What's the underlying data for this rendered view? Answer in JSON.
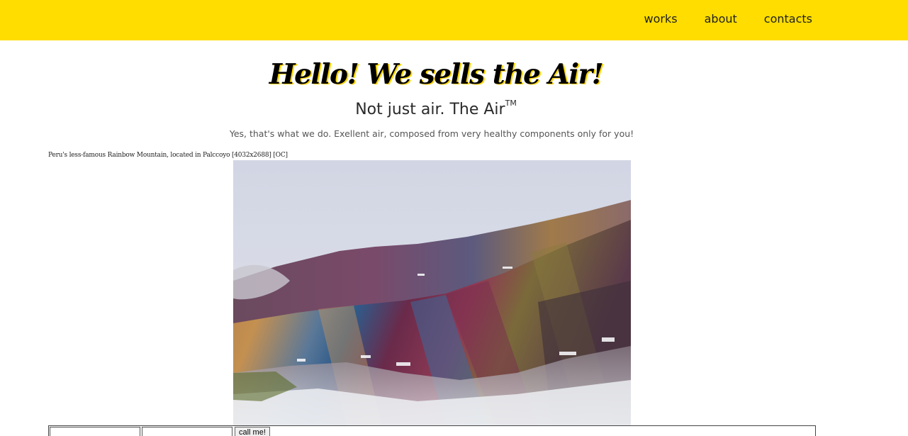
{
  "nav": {
    "items": [
      {
        "label": "works"
      },
      {
        "label": "about"
      },
      {
        "label": "contacts"
      }
    ]
  },
  "hero": {
    "headline": "Hello! We sells the Air!",
    "subheadline": "Not just air. The Air",
    "trademark": "TM",
    "tagline": "Yes, that's what we do. Exellent air, composed from very healthy components only for you!"
  },
  "image": {
    "caption": "Peru's less-famous Rainbow Mountain, located in Palccoyo [4032x2688] [OC]",
    "subject": "rainbow-mountain-photo"
  },
  "form": {
    "field1_value": "",
    "field2_value": "",
    "submit_label": "call me!"
  },
  "colors": {
    "topbar": "#ffdd00",
    "background": "#ffffff",
    "text": "#1f1f1f"
  }
}
